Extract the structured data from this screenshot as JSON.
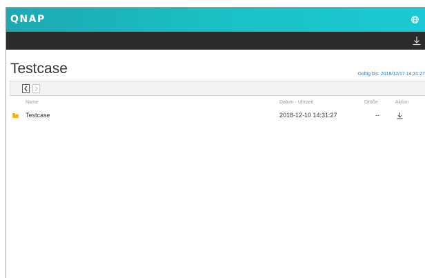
{
  "header": {
    "logo_text": "QNAP",
    "brand_color": "#1cbcc4",
    "globe_icon": "globe-icon"
  },
  "subbar": {
    "download_icon": "download-icon"
  },
  "main": {
    "title": "Testcase",
    "valid_label": "Gültig bis:",
    "valid_value": "2018/12/17 14:31:27"
  },
  "toolbar": {
    "back_icon": "back-arrow-icon",
    "forward_icon": "forward-arrow-icon"
  },
  "table": {
    "columns": [
      "Name",
      "Datum - Uhrzeit",
      "Größe",
      "Aktion"
    ],
    "rows": [
      {
        "icon": "folder-icon",
        "name": "Testcase",
        "datetime": "2018-12-10 14:31:27",
        "size": "--",
        "action_icon": "download-icon"
      }
    ]
  }
}
